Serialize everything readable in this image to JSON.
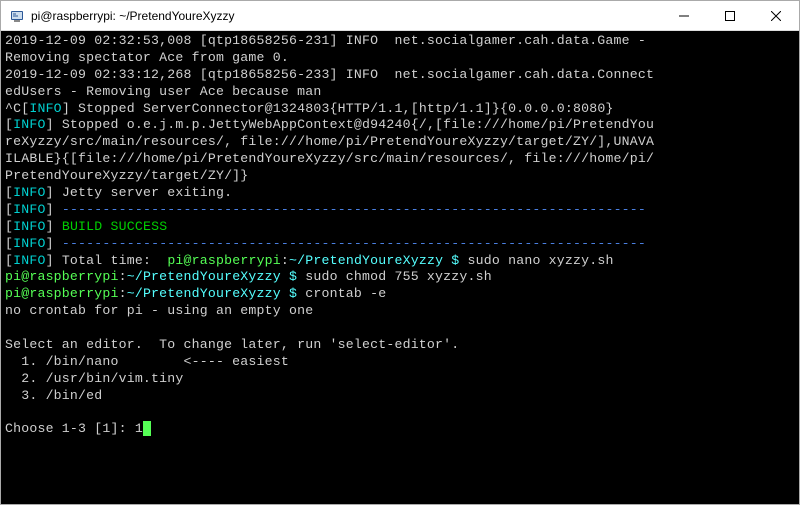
{
  "window": {
    "title": "pi@raspberrypi: ~/PretendYoureXyzzy"
  },
  "term": {
    "l1": "2019-12-09 02:32:53,008 [qtp18658256-231] INFO  net.socialgamer.cah.data.Game -",
    "l2": "Removing spectator Ace from game 0.",
    "l3": "2019-12-09 02:33:12,268 [qtp18658256-233] INFO  net.socialgamer.cah.data.Connect",
    "l4": "edUsers - Removing user Ace because man",
    "l5a": "^C[",
    "l5b": "INFO",
    "l5c": "] Stopped ServerConnector@1324803{HTTP/1.1,[http/1.1]}{0.0.0.0:8080}",
    "l6a": "[",
    "l6b": "INFO",
    "l6c": "] Stopped o.e.j.m.p.JettyWebAppContext@d94240{/,[file:///home/pi/PretendYou",
    "l7": "reXyzzy/src/main/resources/, file:///home/pi/PretendYoureXyzzy/target/ZY/],UNAVA",
    "l8": "ILABLE}{[file:///home/pi/PretendYoureXyzzy/src/main/resources/, file:///home/pi/",
    "l9": "PretendYoureXyzzy/target/ZY/]}",
    "l10a": "[",
    "l10b": "INFO",
    "l10c": "] Jetty server exiting.",
    "dashes": "------------------------------------------------------------------------",
    "l12c": "] ",
    "buildsuccess": "BUILD SUCCESS",
    "l14c": "] Total time:  ",
    "prompt_user": "pi@raspberrypi",
    "colon": ":",
    "prompt_path": "~/PretendYoureXyzzy $",
    "cmd1": " sudo nano xyzzy.sh",
    "cmd2": " sudo chmod 755 xyzzy.sh",
    "cmd3": " crontab -e",
    "l18": "no crontab for pi - using an empty one",
    "blank": " ",
    "l20": "Select an editor.  To change later, run 'select-editor'.",
    "l21": "  1. /bin/nano        <---- easiest",
    "l22": "  2. /usr/bin/vim.tiny",
    "l23": "  3. /bin/ed",
    "l25a": "Choose 1-3 [1]: ",
    "l25b": "1"
  }
}
